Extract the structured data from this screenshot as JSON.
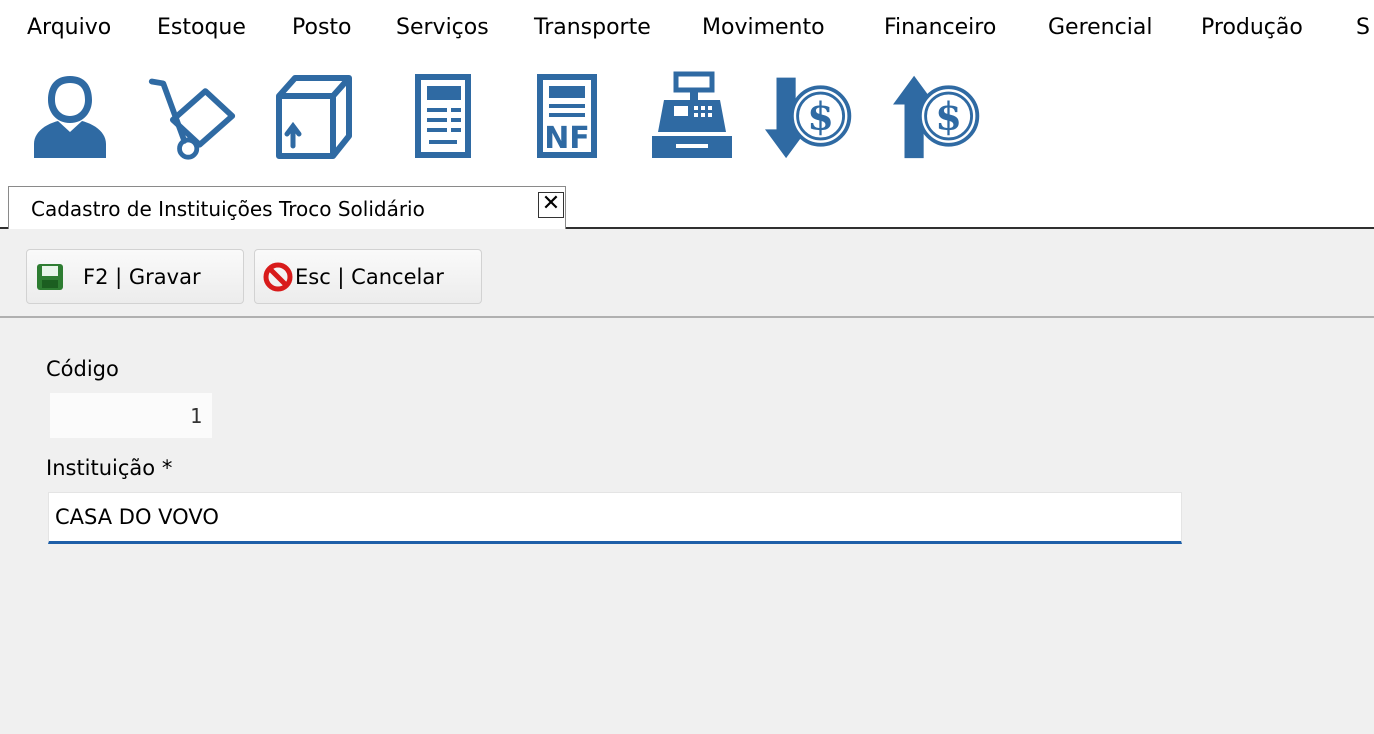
{
  "menu": {
    "items": [
      {
        "label": "Arquivo"
      },
      {
        "label": "Estoque"
      },
      {
        "label": "Posto"
      },
      {
        "label": "Serviços"
      },
      {
        "label": "Transporte"
      },
      {
        "label": "Movimento"
      },
      {
        "label": "Financeiro"
      },
      {
        "label": "Gerencial"
      },
      {
        "label": "Produção"
      },
      {
        "label": "S"
      }
    ]
  },
  "toolbar": {
    "icons": [
      "user-icon",
      "hand-truck-icon",
      "box-icon",
      "document-icon",
      "invoice-nf-icon",
      "cash-register-icon",
      "money-down-icon",
      "money-up-icon"
    ],
    "nf_text": "NF",
    "dollar_text": "$",
    "icon_color": "#2f6aa3"
  },
  "tab": {
    "title": "Cadastro de Instituições Troco Solidário",
    "close_symbol": "✕"
  },
  "actions": {
    "save_label": "F2 | Gravar",
    "cancel_label": "Esc | Cancelar"
  },
  "form": {
    "codigo_label": "Código",
    "codigo_value": "1",
    "instituicao_label": "Instituição *",
    "instituicao_value": "CASA DO VOVO"
  },
  "colors": {
    "accent": "#1e5fa8",
    "save_icon": "#2e7d32",
    "cancel_icon": "#d81b1b"
  }
}
